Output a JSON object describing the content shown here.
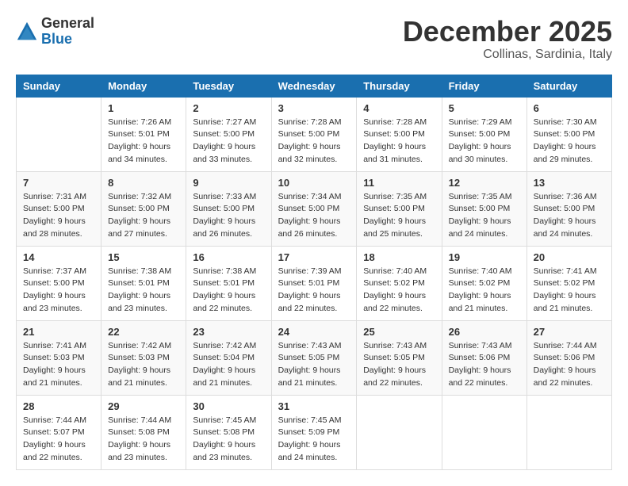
{
  "header": {
    "logo_general": "General",
    "logo_blue": "Blue",
    "month_title": "December 2025",
    "location": "Collinas, Sardinia, Italy"
  },
  "weekdays": [
    "Sunday",
    "Monday",
    "Tuesday",
    "Wednesday",
    "Thursday",
    "Friday",
    "Saturday"
  ],
  "weeks": [
    [
      {
        "day": "",
        "sunrise": "",
        "sunset": "",
        "daylight": ""
      },
      {
        "day": "1",
        "sunrise": "Sunrise: 7:26 AM",
        "sunset": "Sunset: 5:01 PM",
        "daylight": "Daylight: 9 hours and 34 minutes."
      },
      {
        "day": "2",
        "sunrise": "Sunrise: 7:27 AM",
        "sunset": "Sunset: 5:00 PM",
        "daylight": "Daylight: 9 hours and 33 minutes."
      },
      {
        "day": "3",
        "sunrise": "Sunrise: 7:28 AM",
        "sunset": "Sunset: 5:00 PM",
        "daylight": "Daylight: 9 hours and 32 minutes."
      },
      {
        "day": "4",
        "sunrise": "Sunrise: 7:28 AM",
        "sunset": "Sunset: 5:00 PM",
        "daylight": "Daylight: 9 hours and 31 minutes."
      },
      {
        "day": "5",
        "sunrise": "Sunrise: 7:29 AM",
        "sunset": "Sunset: 5:00 PM",
        "daylight": "Daylight: 9 hours and 30 minutes."
      },
      {
        "day": "6",
        "sunrise": "Sunrise: 7:30 AM",
        "sunset": "Sunset: 5:00 PM",
        "daylight": "Daylight: 9 hours and 29 minutes."
      }
    ],
    [
      {
        "day": "7",
        "sunrise": "Sunrise: 7:31 AM",
        "sunset": "Sunset: 5:00 PM",
        "daylight": "Daylight: 9 hours and 28 minutes."
      },
      {
        "day": "8",
        "sunrise": "Sunrise: 7:32 AM",
        "sunset": "Sunset: 5:00 PM",
        "daylight": "Daylight: 9 hours and 27 minutes."
      },
      {
        "day": "9",
        "sunrise": "Sunrise: 7:33 AM",
        "sunset": "Sunset: 5:00 PM",
        "daylight": "Daylight: 9 hours and 26 minutes."
      },
      {
        "day": "10",
        "sunrise": "Sunrise: 7:34 AM",
        "sunset": "Sunset: 5:00 PM",
        "daylight": "Daylight: 9 hours and 26 minutes."
      },
      {
        "day": "11",
        "sunrise": "Sunrise: 7:35 AM",
        "sunset": "Sunset: 5:00 PM",
        "daylight": "Daylight: 9 hours and 25 minutes."
      },
      {
        "day": "12",
        "sunrise": "Sunrise: 7:35 AM",
        "sunset": "Sunset: 5:00 PM",
        "daylight": "Daylight: 9 hours and 24 minutes."
      },
      {
        "day": "13",
        "sunrise": "Sunrise: 7:36 AM",
        "sunset": "Sunset: 5:00 PM",
        "daylight": "Daylight: 9 hours and 24 minutes."
      }
    ],
    [
      {
        "day": "14",
        "sunrise": "Sunrise: 7:37 AM",
        "sunset": "Sunset: 5:00 PM",
        "daylight": "Daylight: 9 hours and 23 minutes."
      },
      {
        "day": "15",
        "sunrise": "Sunrise: 7:38 AM",
        "sunset": "Sunset: 5:01 PM",
        "daylight": "Daylight: 9 hours and 23 minutes."
      },
      {
        "day": "16",
        "sunrise": "Sunrise: 7:38 AM",
        "sunset": "Sunset: 5:01 PM",
        "daylight": "Daylight: 9 hours and 22 minutes."
      },
      {
        "day": "17",
        "sunrise": "Sunrise: 7:39 AM",
        "sunset": "Sunset: 5:01 PM",
        "daylight": "Daylight: 9 hours and 22 minutes."
      },
      {
        "day": "18",
        "sunrise": "Sunrise: 7:40 AM",
        "sunset": "Sunset: 5:02 PM",
        "daylight": "Daylight: 9 hours and 22 minutes."
      },
      {
        "day": "19",
        "sunrise": "Sunrise: 7:40 AM",
        "sunset": "Sunset: 5:02 PM",
        "daylight": "Daylight: 9 hours and 21 minutes."
      },
      {
        "day": "20",
        "sunrise": "Sunrise: 7:41 AM",
        "sunset": "Sunset: 5:02 PM",
        "daylight": "Daylight: 9 hours and 21 minutes."
      }
    ],
    [
      {
        "day": "21",
        "sunrise": "Sunrise: 7:41 AM",
        "sunset": "Sunset: 5:03 PM",
        "daylight": "Daylight: 9 hours and 21 minutes."
      },
      {
        "day": "22",
        "sunrise": "Sunrise: 7:42 AM",
        "sunset": "Sunset: 5:03 PM",
        "daylight": "Daylight: 9 hours and 21 minutes."
      },
      {
        "day": "23",
        "sunrise": "Sunrise: 7:42 AM",
        "sunset": "Sunset: 5:04 PM",
        "daylight": "Daylight: 9 hours and 21 minutes."
      },
      {
        "day": "24",
        "sunrise": "Sunrise: 7:43 AM",
        "sunset": "Sunset: 5:05 PM",
        "daylight": "Daylight: 9 hours and 21 minutes."
      },
      {
        "day": "25",
        "sunrise": "Sunrise: 7:43 AM",
        "sunset": "Sunset: 5:05 PM",
        "daylight": "Daylight: 9 hours and 22 minutes."
      },
      {
        "day": "26",
        "sunrise": "Sunrise: 7:43 AM",
        "sunset": "Sunset: 5:06 PM",
        "daylight": "Daylight: 9 hours and 22 minutes."
      },
      {
        "day": "27",
        "sunrise": "Sunrise: 7:44 AM",
        "sunset": "Sunset: 5:06 PM",
        "daylight": "Daylight: 9 hours and 22 minutes."
      }
    ],
    [
      {
        "day": "28",
        "sunrise": "Sunrise: 7:44 AM",
        "sunset": "Sunset: 5:07 PM",
        "daylight": "Daylight: 9 hours and 22 minutes."
      },
      {
        "day": "29",
        "sunrise": "Sunrise: 7:44 AM",
        "sunset": "Sunset: 5:08 PM",
        "daylight": "Daylight: 9 hours and 23 minutes."
      },
      {
        "day": "30",
        "sunrise": "Sunrise: 7:45 AM",
        "sunset": "Sunset: 5:08 PM",
        "daylight": "Daylight: 9 hours and 23 minutes."
      },
      {
        "day": "31",
        "sunrise": "Sunrise: 7:45 AM",
        "sunset": "Sunset: 5:09 PM",
        "daylight": "Daylight: 9 hours and 24 minutes."
      },
      {
        "day": "",
        "sunrise": "",
        "sunset": "",
        "daylight": ""
      },
      {
        "day": "",
        "sunrise": "",
        "sunset": "",
        "daylight": ""
      },
      {
        "day": "",
        "sunrise": "",
        "sunset": "",
        "daylight": ""
      }
    ]
  ]
}
